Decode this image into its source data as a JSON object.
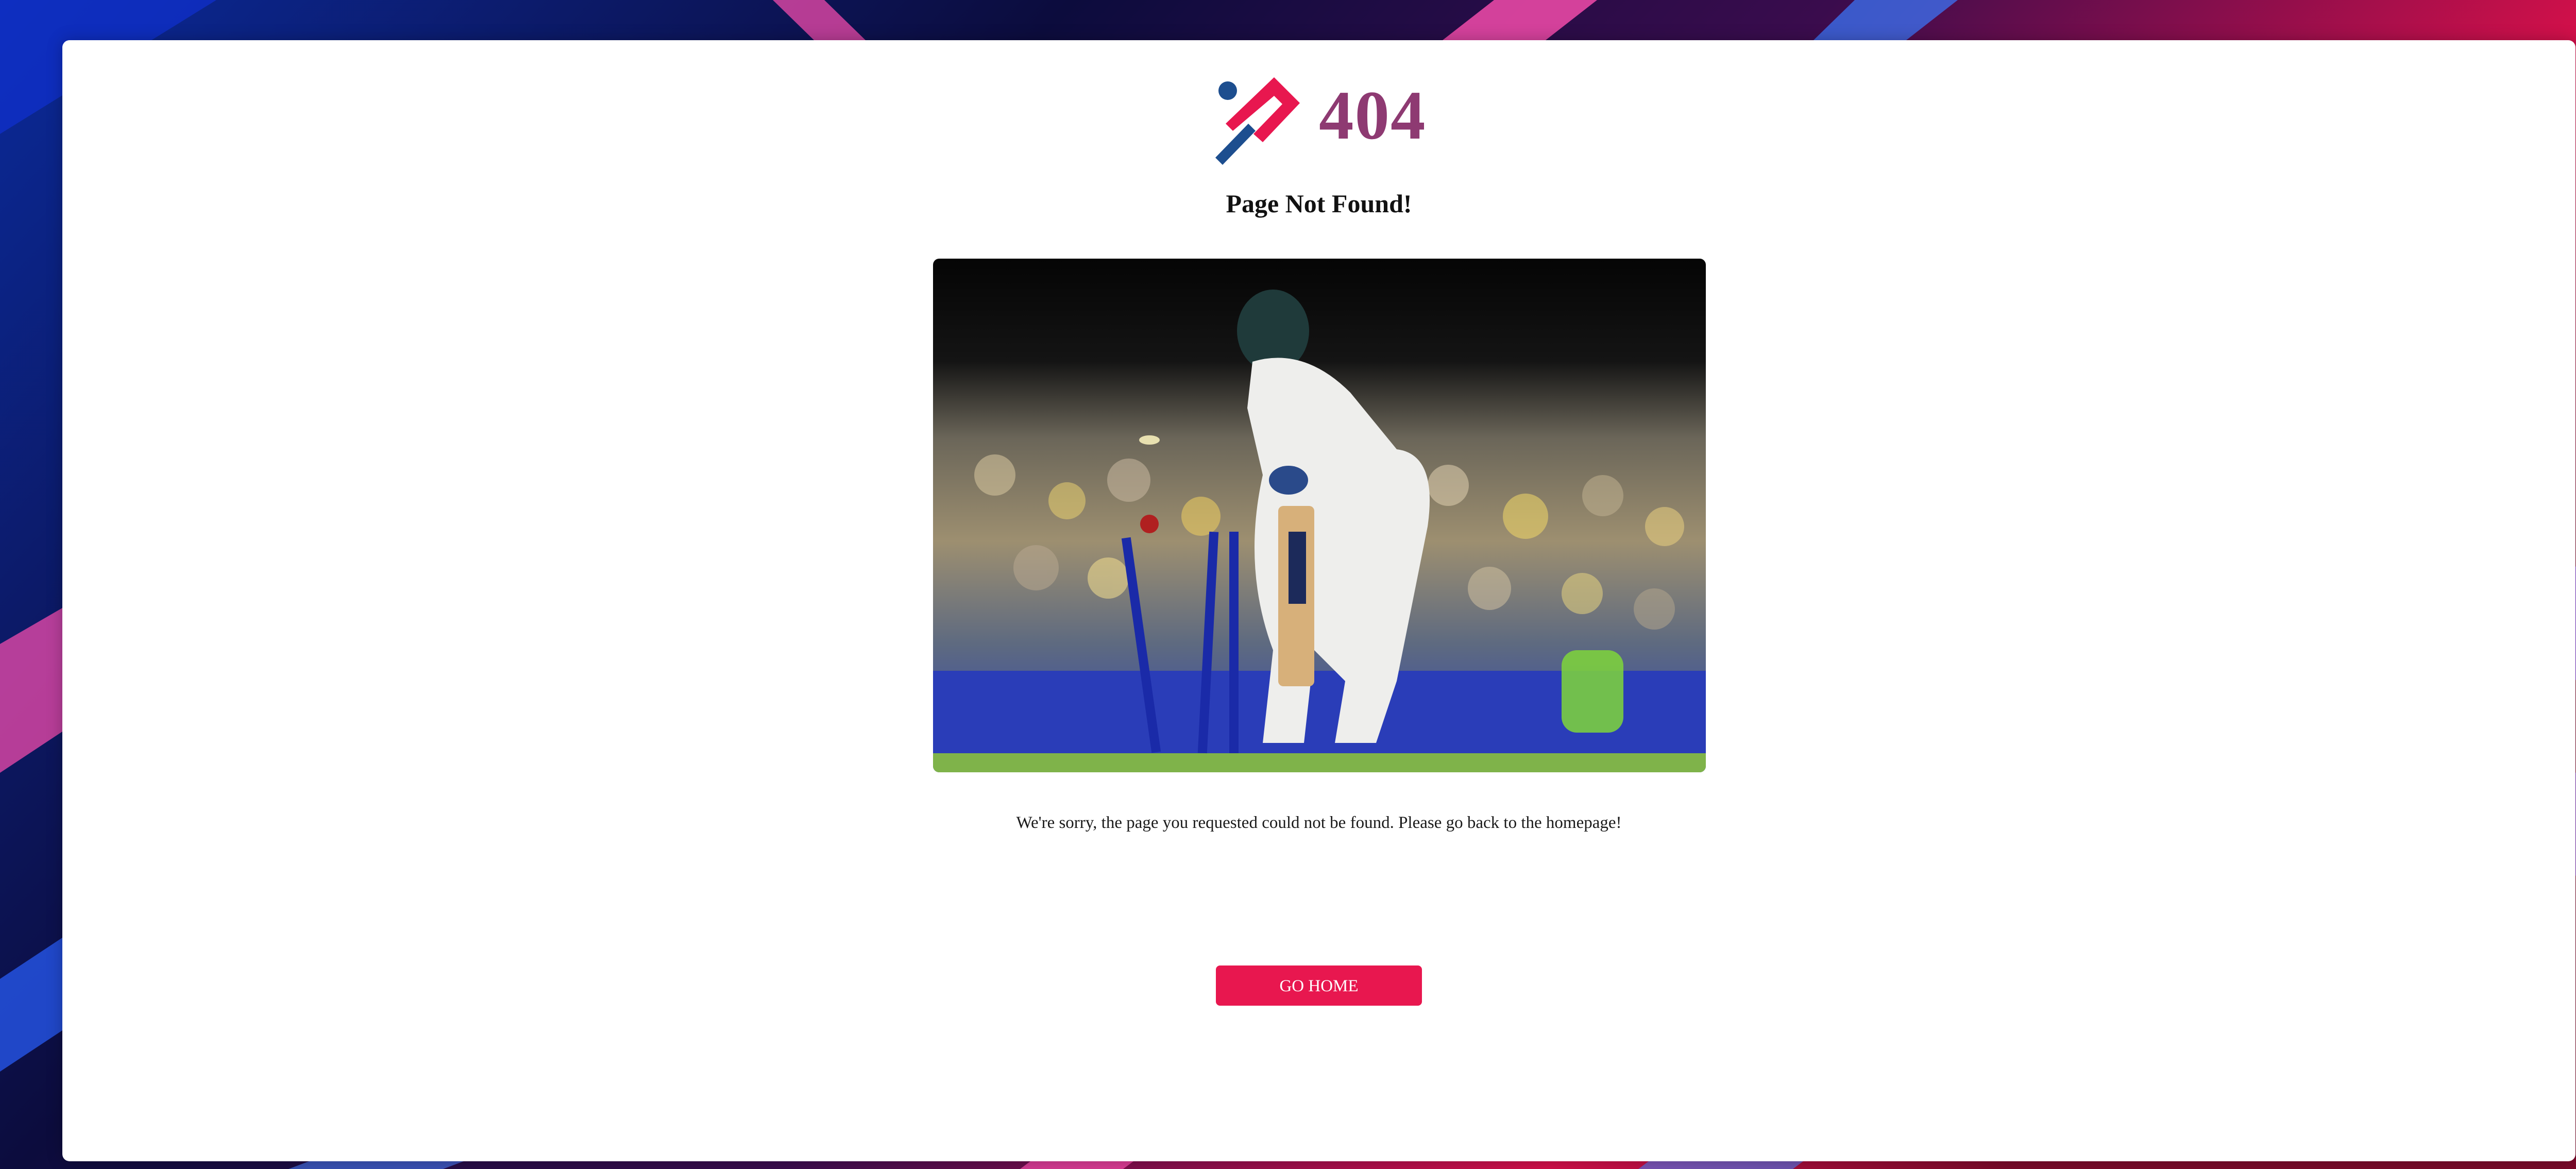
{
  "error": {
    "code": "404",
    "heading": "Page Not Found!",
    "message": "We're sorry, the page you requested could not be found. Please go back to the homepage!",
    "button_label": "GO HOME",
    "photo_subject": "cricket batsman bowled, stumps broken, stadium crowd"
  },
  "colors": {
    "accent": "#e8174f",
    "code_text": "#8e3a72",
    "logo_blue": "#1d4e8f",
    "logo_pink": "#e8174f"
  },
  "icons": {
    "logo": "cricket-logo-icon"
  }
}
